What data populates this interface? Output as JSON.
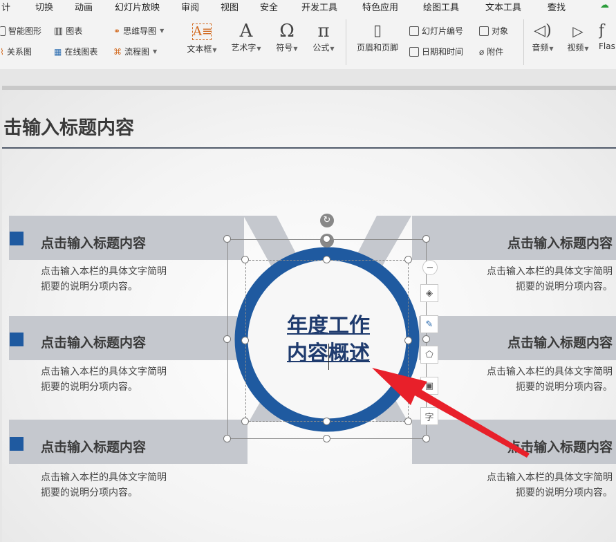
{
  "menubar": {
    "tabs": [
      "计",
      "切换",
      "动画",
      "幻灯片放映",
      "审阅",
      "视图",
      "安全",
      "开发工具",
      "特色应用",
      "绘图工具",
      "文本工具",
      "查找"
    ]
  },
  "ribbon": {
    "smart_art": "智能图形",
    "chart": "图表",
    "mind_map": "思维导图",
    "relation_graph": "关系图",
    "online_chart": "在线图表",
    "flowchart": "流程图",
    "text_box": "文本框",
    "art_text": "艺术字",
    "symbol": "符号",
    "formula": "公式",
    "header_footer": "页眉和页脚",
    "slide_number": "幻灯片编号",
    "object": "对象",
    "date_time": "日期和时间",
    "attachment": "附件",
    "audio": "音频",
    "video": "视频",
    "flash": "Flas"
  },
  "slide": {
    "title": "击输入标题内容",
    "center_line1": "年度工作",
    "center_line2": "内容概述",
    "left": [
      {
        "heading": "点击输入标题内容",
        "line1": "点击输入本栏的具体文字简明",
        "line2": "扼要的说明分项内容。"
      },
      {
        "heading": "点击输入标题内容",
        "line1": "点击输入本栏的具体文字简明",
        "line2": "扼要的说明分项内容。"
      },
      {
        "heading": "点击输入标题内容",
        "line1": "点击输入本栏的具体文字简明",
        "line2": "扼要的说明分项内容。"
      }
    ],
    "right": [
      {
        "heading": "点击输入标题内容",
        "line1": "点击输入本栏的具体文字简明",
        "line2": "扼要的说明分项内容。"
      },
      {
        "heading": "点击输入标题内容",
        "line1": "点击输入本栏的具体文字简明",
        "line2": "扼要的说明分项内容。"
      },
      {
        "heading": "点击输入标题内容",
        "line1": "点击输入本栏的具体文字简明",
        "line2": "扼要的说明分项内容。"
      }
    ]
  },
  "side_toolbar": [
    "−",
    "字"
  ],
  "colors": {
    "accent": "#1f5aa0",
    "band": "#c5c8ce",
    "arrow": "#e8202a"
  }
}
